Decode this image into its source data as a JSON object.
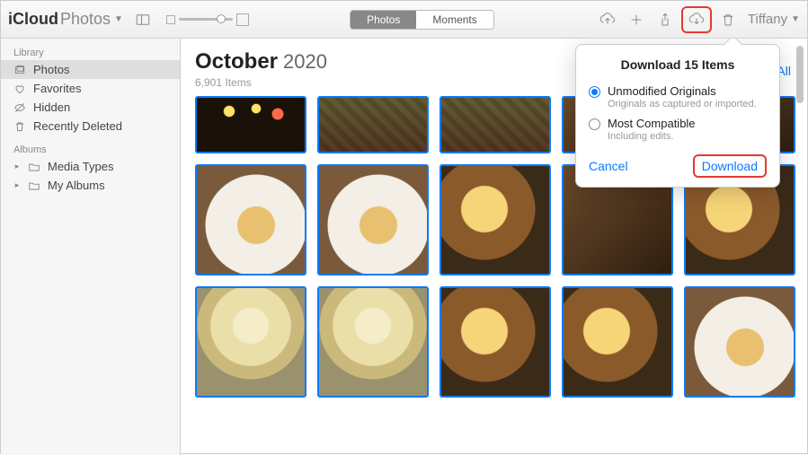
{
  "app": {
    "title_bold": "iCloud",
    "title_light": "Photos"
  },
  "segmented": {
    "photos": "Photos",
    "moments": "Moments"
  },
  "user": {
    "name": "Tiffany"
  },
  "sidebar": {
    "section_library": "Library",
    "section_albums": "Albums",
    "library": [
      {
        "label": "Photos",
        "icon": "photos-icon",
        "selected": true
      },
      {
        "label": "Favorites",
        "icon": "heart-icon",
        "selected": false
      },
      {
        "label": "Hidden",
        "icon": "eye-off-icon",
        "selected": false
      },
      {
        "label": "Recently Deleted",
        "icon": "trash-icon",
        "selected": false
      }
    ],
    "albums": [
      {
        "label": "Media Types",
        "icon": "folder-icon"
      },
      {
        "label": "My Albums",
        "icon": "folder-icon"
      }
    ]
  },
  "header": {
    "month": "October",
    "year": "2020",
    "item_count": "6,901 Items",
    "select_all": "Select All"
  },
  "popover": {
    "title": "Download 15 Items",
    "options": [
      {
        "label": "Unmodified Originals",
        "sub": "Originals as captured or imported.",
        "checked": true
      },
      {
        "label": "Most Compatible",
        "sub": "Including edits.",
        "checked": false
      }
    ],
    "cancel": "Cancel",
    "download": "Download"
  }
}
